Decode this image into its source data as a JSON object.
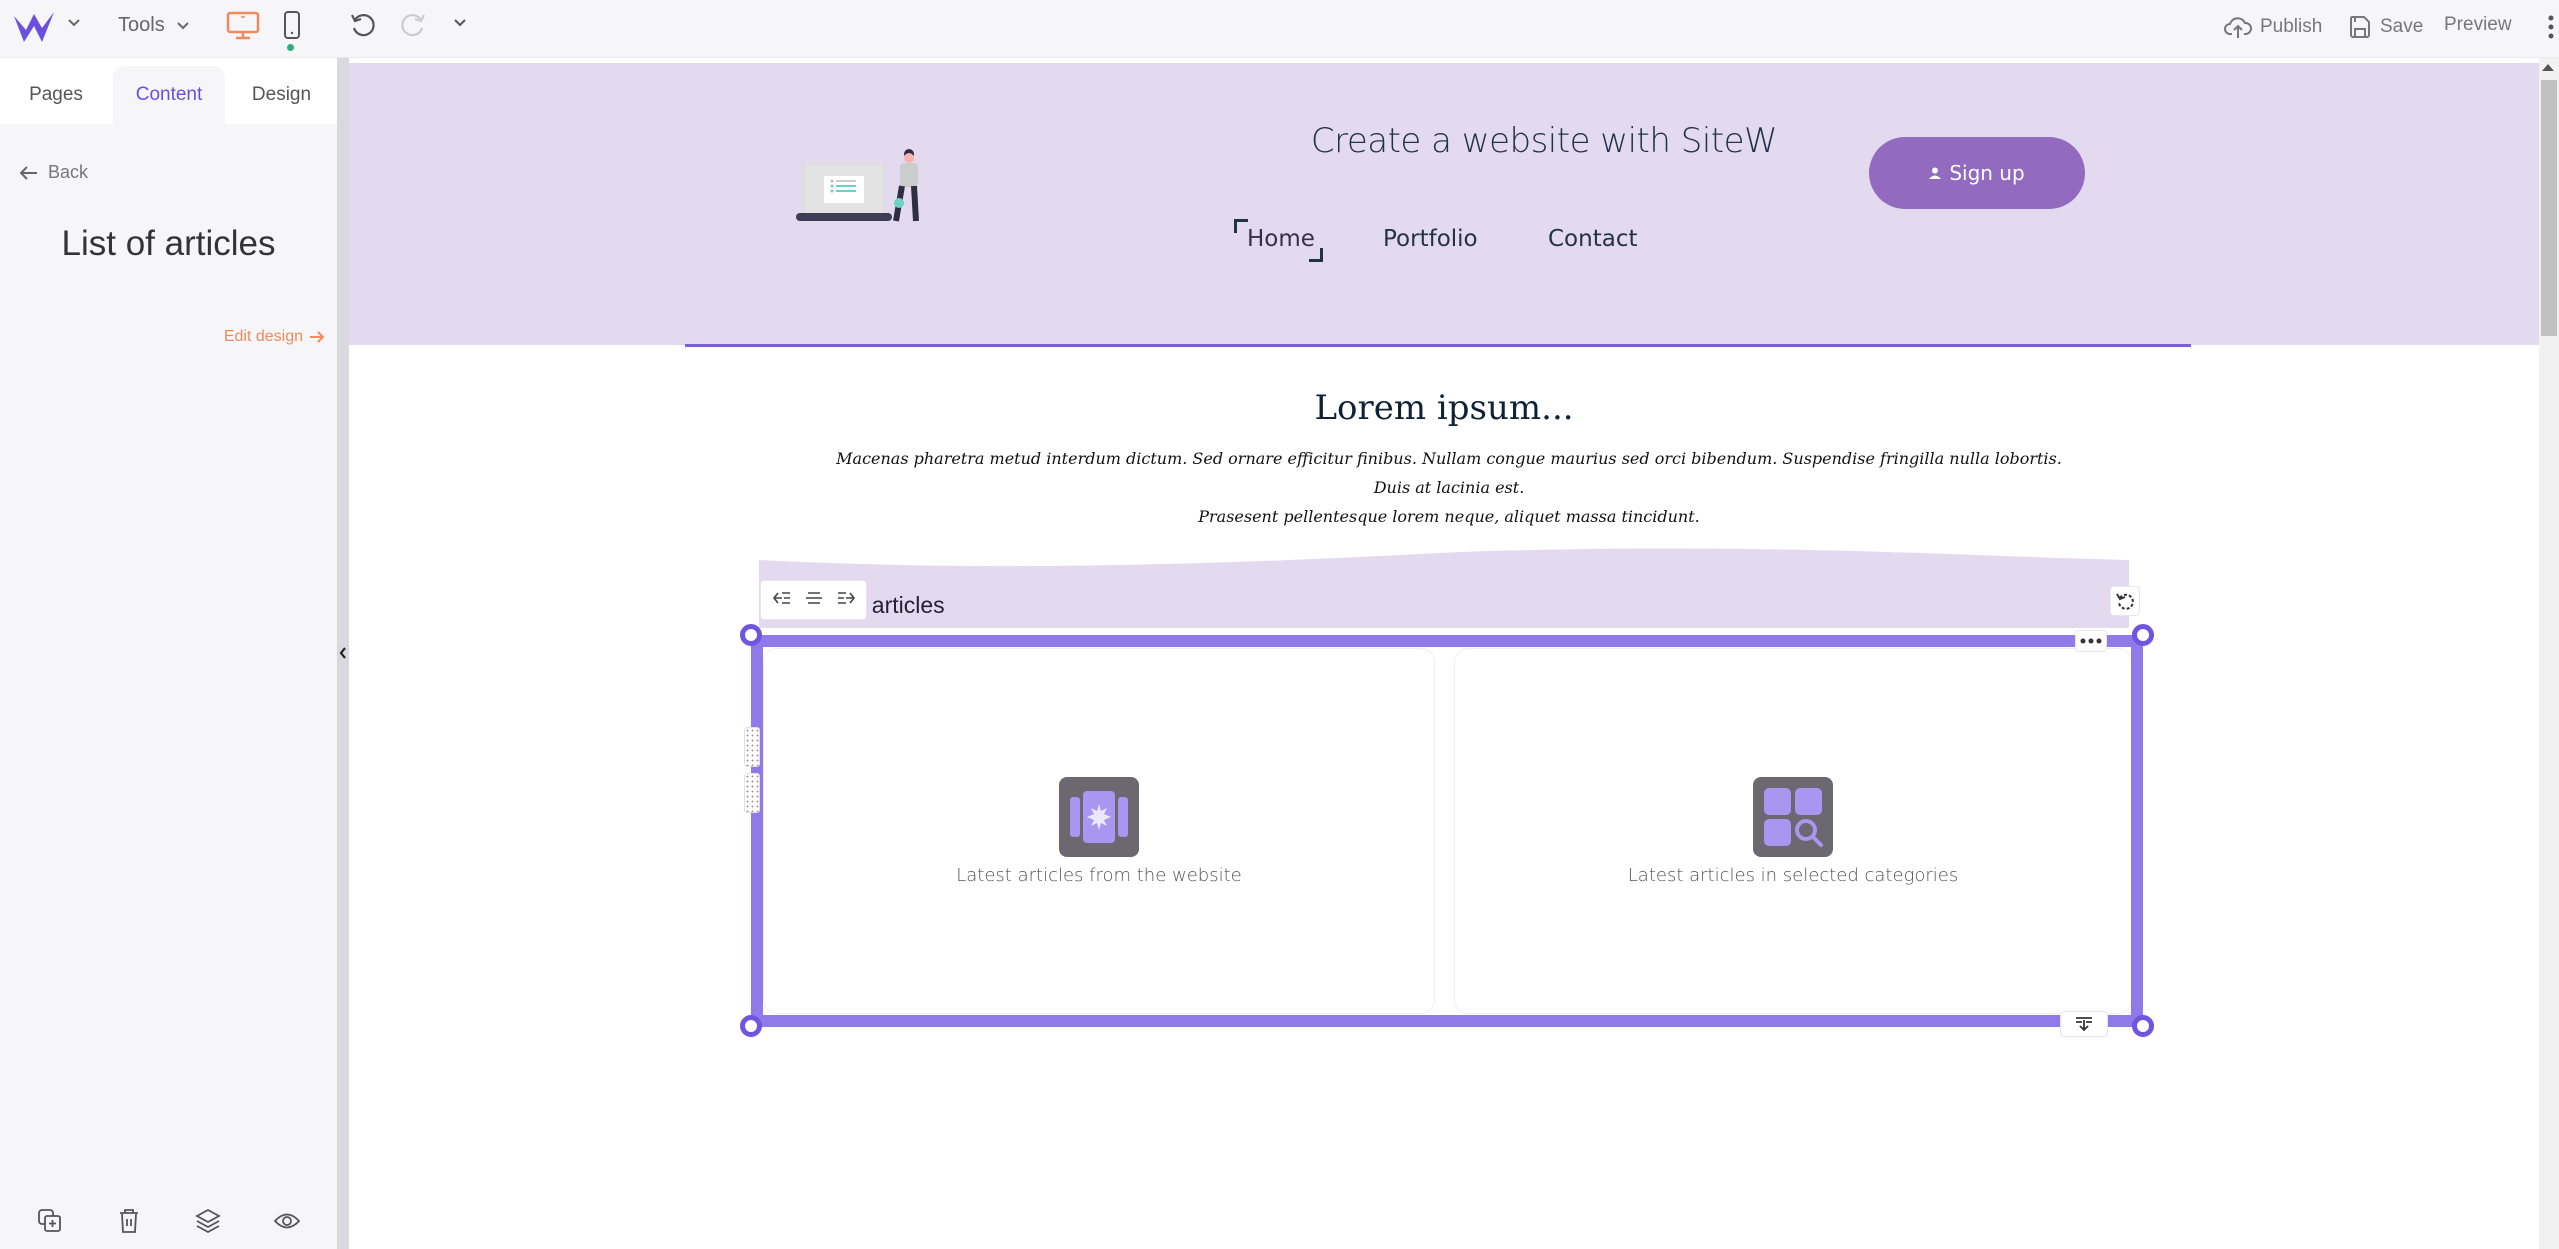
{
  "topbar": {
    "tools_label": "Tools",
    "publish_label": "Publish",
    "save_label": "Save",
    "preview_label": "Preview",
    "logo_icon": "sitew-logo",
    "device_active": "desktop",
    "colors": {
      "accent": "#6a4fe0",
      "desktop_active": "#f08a5d",
      "status_dot": "#2ab07a"
    }
  },
  "sidebar": {
    "tabs": [
      {
        "label": "Pages",
        "active": false
      },
      {
        "label": "Content",
        "active": true
      },
      {
        "label": "Design",
        "active": false
      }
    ],
    "back_label": "Back",
    "title": "List of articles",
    "edit_design_label": "Edit design",
    "bottom_actions": [
      "duplicate-icon",
      "trash-icon",
      "layers-icon",
      "eye-icon"
    ]
  },
  "site": {
    "title": "Create a website with SiteW",
    "nav": [
      "Home",
      "Portfolio",
      "Contact"
    ],
    "nav_active": "Home",
    "signup_label": "Sign up",
    "colors": {
      "header_bg": "#e3daf0",
      "signup_bg": "#926abf",
      "selection": "#9079e8"
    },
    "lorem_title": "Lorem ipsum...",
    "lorem_body_line1": "Macenas pharetra metud interdum dictum. Sed ornare efficitur finibus. Nullam congue maurius sed orci bibendum. Suspendise fringilla nulla lobortis. Duis at lacinia est.",
    "lorem_body_line2": "Prasesent pellentesque lorem neque, aliquet massa tincidunt.",
    "block_label": "List of articles",
    "block_label_visible": "t articles",
    "options": [
      {
        "label": "Latest articles from the website",
        "icon": "carousel-star-icon"
      },
      {
        "label": "Latest articles in selected categories",
        "icon": "category-search-icon"
      }
    ]
  }
}
